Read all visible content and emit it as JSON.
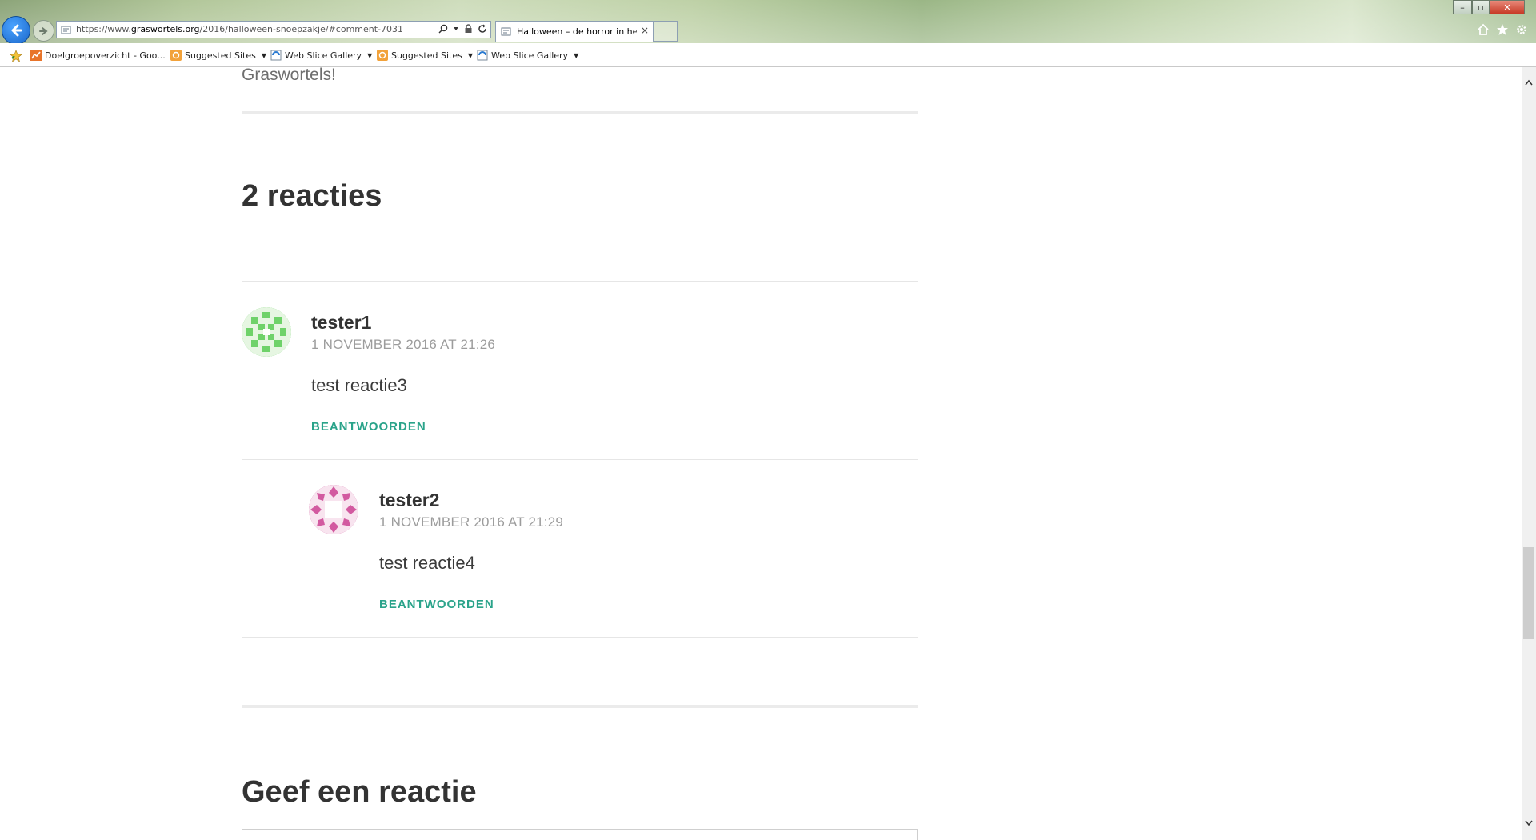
{
  "browser": {
    "url_prefix": "https://www.",
    "url_domain": "graswortels.org",
    "url_path": "/2016/halloween-snoepzakje/#comment-7031",
    "tab_title": "Halloween – de horror in he...",
    "tab_close": "×",
    "window_controls": {
      "minimize": "–",
      "maximize": "▫",
      "close": "✕"
    },
    "favorites": [
      {
        "label": "Doelgroepoverzicht - Goo...",
        "dropdown": false
      },
      {
        "label": "Suggested Sites",
        "dropdown": true
      },
      {
        "label": "Web Slice Gallery",
        "dropdown": true
      },
      {
        "label": "Suggested Sites",
        "dropdown": true
      },
      {
        "label": "Web Slice Gallery",
        "dropdown": true
      }
    ]
  },
  "page": {
    "prev_text": "Graswortels!",
    "comments_heading": "2 reacties",
    "comments": [
      {
        "author": "tester1",
        "date": "1 NOVEMBER 2016 AT 21:26",
        "text": "test reactie3",
        "reply_label": "BEANTWOORDEN",
        "avatar_color": "#6fd26a",
        "depth": 0
      },
      {
        "author": "tester2",
        "date": "1 NOVEMBER 2016 AT 21:29",
        "text": "test reactie4",
        "reply_label": "BEANTWOORDEN",
        "avatar_color": "#d25aa0",
        "depth": 1
      }
    ],
    "reply_heading": "Geef een reactie"
  },
  "colors": {
    "accent": "#2aa38a",
    "date_gray": "#9c9c9c",
    "heading": "#333333"
  }
}
